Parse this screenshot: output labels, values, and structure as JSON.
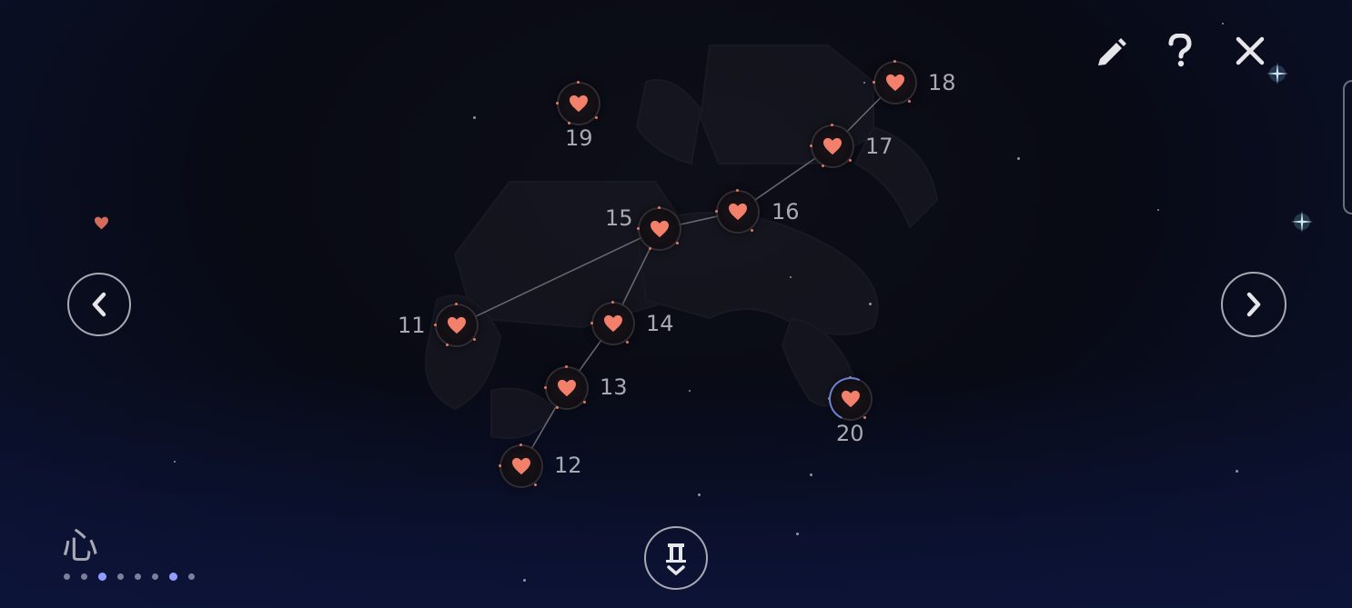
{
  "constellation": {
    "nodes": [
      {
        "id": "node-11",
        "label": "11"
      },
      {
        "id": "node-12",
        "label": "12"
      },
      {
        "id": "node-13",
        "label": "13"
      },
      {
        "id": "node-14",
        "label": "14"
      },
      {
        "id": "node-15",
        "label": "15"
      },
      {
        "id": "node-16",
        "label": "16"
      },
      {
        "id": "node-17",
        "label": "17"
      },
      {
        "id": "node-18",
        "label": "18"
      },
      {
        "id": "node-19",
        "label": "19"
      },
      {
        "id": "node-20",
        "label": "20"
      }
    ],
    "connections": [
      [
        "11",
        "15"
      ],
      [
        "15",
        "16"
      ],
      [
        "16",
        "17"
      ],
      [
        "17",
        "18"
      ],
      [
        "15",
        "14"
      ],
      [
        "14",
        "13"
      ],
      [
        "13",
        "12"
      ]
    ]
  },
  "toolbar": {
    "edit_icon": "pencil-icon",
    "help_icon": "question-icon",
    "close_icon": "close-icon"
  },
  "navigation": {
    "prev_icon": "chevron-left-icon",
    "next_icon": "chevron-right-icon",
    "bottom_icon": "gate-down-icon"
  },
  "page_indicator": {
    "glyph": "心",
    "total": 8,
    "active_indices": [
      2,
      6
    ]
  },
  "colors": {
    "heart": "#f2806a",
    "line": "#6a6a74",
    "active_dot": "#8f9dff",
    "progress_arc": "#6a7fd0"
  }
}
